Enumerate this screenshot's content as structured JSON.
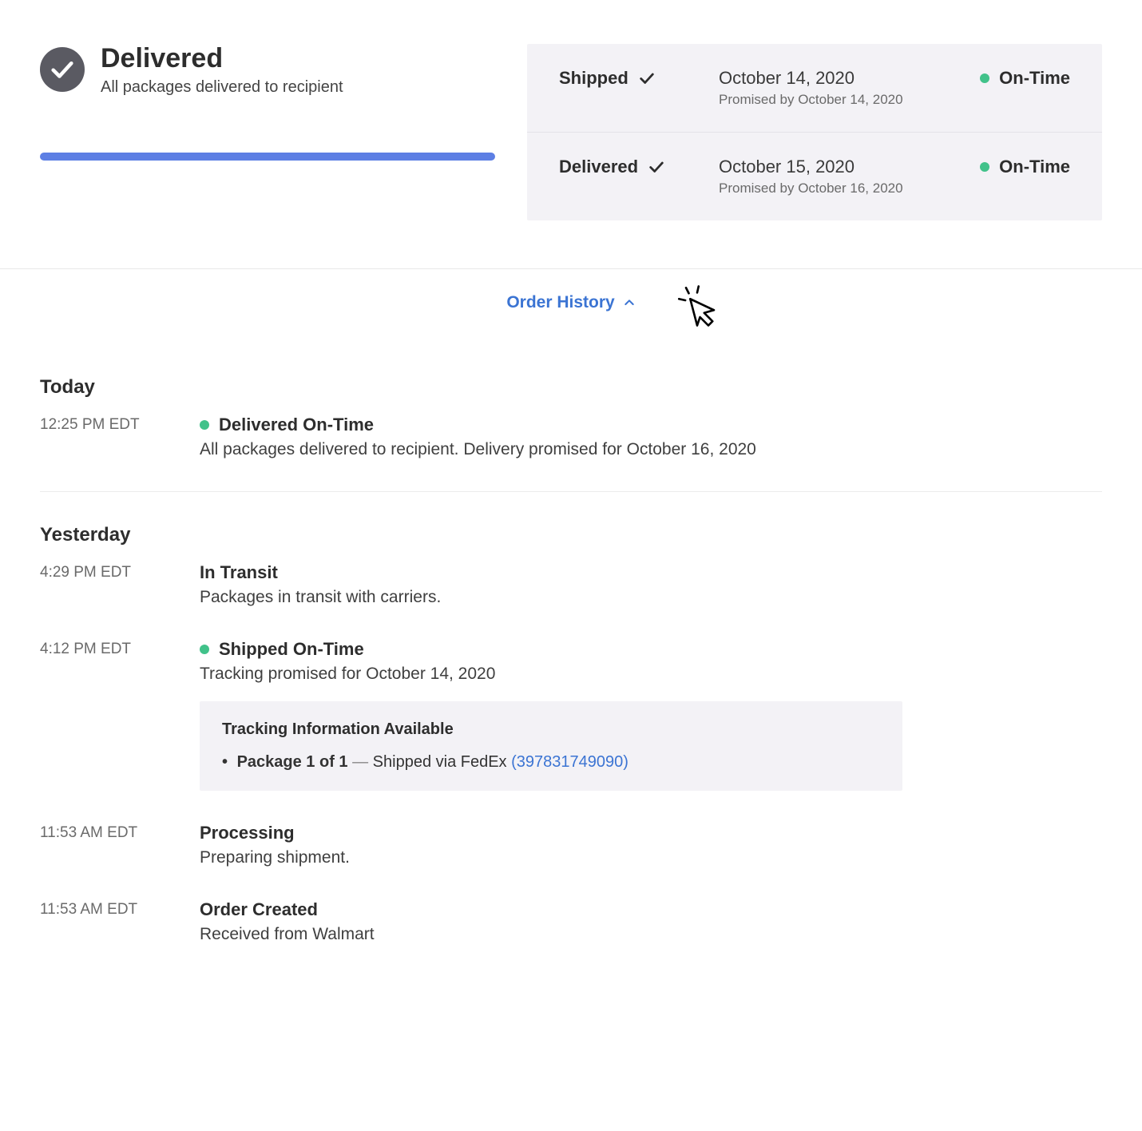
{
  "status": {
    "title": "Delivered",
    "subtitle": "All packages delivered to recipient"
  },
  "milestones": [
    {
      "label": "Shipped",
      "date": "October 14, 2020",
      "promised": "Promised by October 14, 2020",
      "status": "On-Time"
    },
    {
      "label": "Delivered",
      "date": "October 15, 2020",
      "promised": "Promised by October 16, 2020",
      "status": "On-Time"
    }
  ],
  "order_history_toggle": "Order History",
  "history": [
    {
      "day_label": "Today",
      "events": [
        {
          "time": "12:25 PM EDT",
          "title": "Delivered On-Time",
          "has_dot": true,
          "desc": "All packages delivered to recipient. Delivery promised for October 16, 2020"
        }
      ]
    },
    {
      "day_label": "Yesterday",
      "events": [
        {
          "time": "4:29 PM EDT",
          "title": "In Transit",
          "has_dot": false,
          "desc": "Packages in transit with carriers."
        },
        {
          "time": "4:12 PM EDT",
          "title": "Shipped On-Time",
          "has_dot": true,
          "desc": "Tracking promised for October 14, 2020",
          "tracking": {
            "title": "Tracking Information Available",
            "package_label": "Package 1 of 1",
            "separator": " — ",
            "via": "Shipped via FedEx ",
            "link_text": "(397831749090)"
          }
        },
        {
          "time": "11:53 AM EDT",
          "title": "Processing",
          "has_dot": false,
          "desc": "Preparing shipment."
        },
        {
          "time": "11:53 AM EDT",
          "title": "Order Created",
          "has_dot": false,
          "desc": "Received from Walmart"
        }
      ]
    }
  ]
}
